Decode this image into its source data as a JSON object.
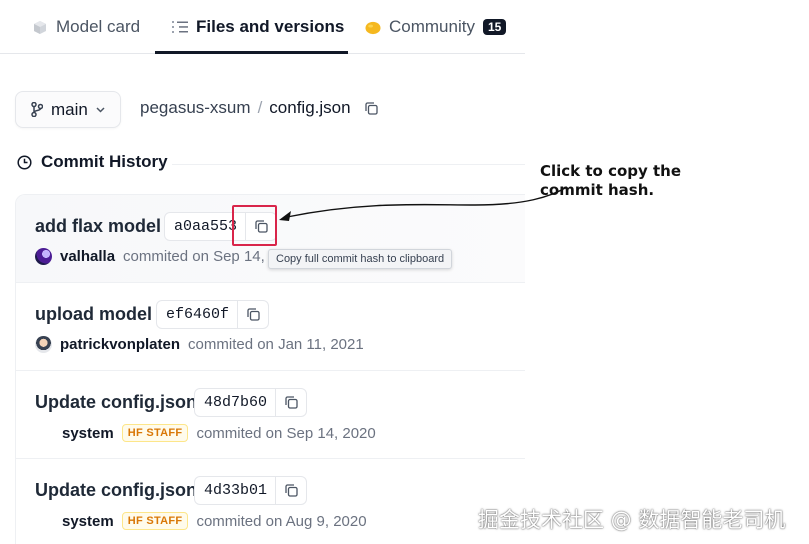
{
  "tabs": [
    {
      "label": "Model card",
      "icon": "cube-icon"
    },
    {
      "label": "Files and versions",
      "icon": "files-icon"
    },
    {
      "label": "Community",
      "icon": "community-icon",
      "count": "15"
    }
  ],
  "branch": {
    "label": "main"
  },
  "breadcrumb": {
    "repo": "pegasus-xsum",
    "separator": "/",
    "file": "config.json"
  },
  "commit_history": {
    "title": "Commit History"
  },
  "commits": [
    {
      "title": "add flax model",
      "hash": "a0aa553",
      "author": "valhalla",
      "staff": "",
      "meta": "commited on Sep 14, 2"
    },
    {
      "title": "upload model",
      "hash": "ef6460f",
      "author": "patrickvonplaten",
      "staff": "",
      "meta": "commited on Jan 11, 2021"
    },
    {
      "title": "Update config.json",
      "hash": "48d7b60",
      "author": "system",
      "staff": "HF STAFF",
      "meta": "commited on Sep 14, 2020"
    },
    {
      "title": "Update config.json",
      "hash": "4d33b01",
      "author": "system",
      "staff": "HF STAFF",
      "meta": "commited on Aug 9, 2020"
    }
  ],
  "tooltip": {
    "text": "Copy full commit hash to clipboard"
  },
  "annotation": {
    "line1": "Click to copy the",
    "line2": "commit hash."
  },
  "watermark": {
    "text": "掘金技术社区 @ 数据智能老司机"
  },
  "colors": {
    "highlight": "#d9254a",
    "staff": "#d97706",
    "community": "#f5b81f"
  }
}
